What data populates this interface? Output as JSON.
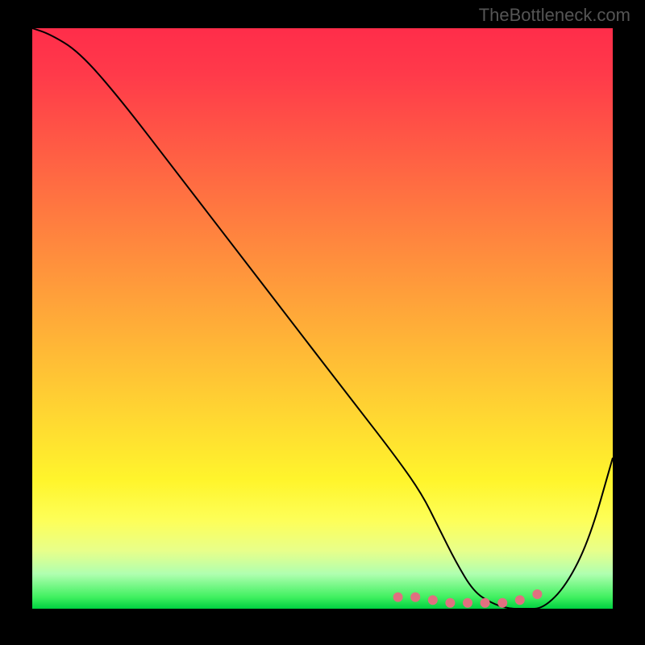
{
  "watermark": "TheBottleneck.com",
  "chart_data": {
    "type": "line",
    "title": "",
    "xlabel": "",
    "ylabel": "",
    "xlim": [
      0,
      100
    ],
    "ylim": [
      0,
      100
    ],
    "x": [
      0,
      3,
      8,
      15,
      25,
      35,
      45,
      55,
      62,
      67,
      70,
      73,
      76,
      79,
      82,
      85,
      88,
      92,
      96,
      100
    ],
    "values": [
      100,
      99,
      96,
      88,
      75,
      62,
      49,
      36,
      27,
      20,
      14,
      8,
      3,
      1,
      0,
      0,
      0,
      4,
      12,
      26
    ],
    "markers": {
      "style": "rose dotted segment at trough",
      "x": [
        63,
        66,
        69,
        72,
        75,
        78,
        81,
        84,
        87
      ],
      "y": [
        2,
        2,
        1.5,
        1,
        1,
        1,
        1,
        1.5,
        2.5
      ]
    },
    "gradient": {
      "top_color": "#ff2d4a",
      "mid_color": "#ffe030",
      "bottom_color": "#00d040"
    }
  }
}
